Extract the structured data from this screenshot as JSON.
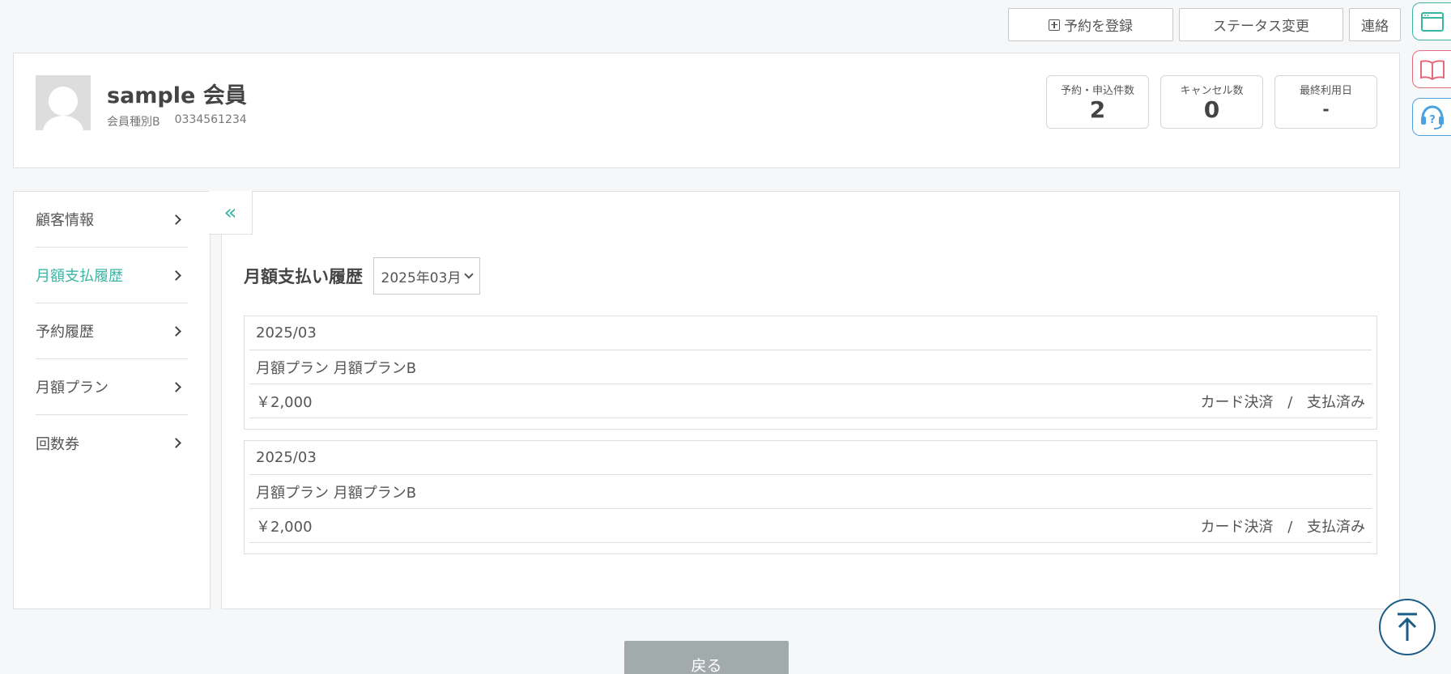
{
  "top_actions": {
    "reserve_label": "予約を登録",
    "status_label": "ステータス変更",
    "contact_label": "連絡"
  },
  "side_icons": [
    "browser-window-icon",
    "book-icon",
    "help-headset-icon"
  ],
  "profile": {
    "name": "sample 会員",
    "member_type": "会員種別B",
    "phone": "0334561234",
    "stats": [
      {
        "label": "予約・申込件数",
        "value": "2"
      },
      {
        "label": "キャンセル数",
        "value": "0"
      },
      {
        "label": "最終利用日",
        "value": "-"
      }
    ]
  },
  "sidebar": {
    "items": [
      {
        "label": "顧客情報",
        "active": false
      },
      {
        "label": "月額支払履歴",
        "active": true
      },
      {
        "label": "予約履歴",
        "active": false
      },
      {
        "label": "月額プラン",
        "active": false
      },
      {
        "label": "回数券",
        "active": false
      }
    ],
    "collapse_glyph": "«"
  },
  "main": {
    "title": "月額支払い履歴",
    "selected_month": "2025年03月",
    "records": [
      {
        "month": "2025/03",
        "plan": "月額プラン 月額プランB",
        "amount": "￥2,000",
        "payment": "カード決済",
        "separator": "/",
        "status": "支払済み"
      },
      {
        "month": "2025/03",
        "plan": "月額プラン 月額プランB",
        "amount": "￥2,000",
        "payment": "カード決済",
        "separator": "/",
        "status": "支払済み"
      }
    ]
  },
  "back_label": "戻る",
  "colors": {
    "accent": "#3bb5a3",
    "back_button": "#a2abab",
    "scroll_top": "#1b5c86"
  }
}
